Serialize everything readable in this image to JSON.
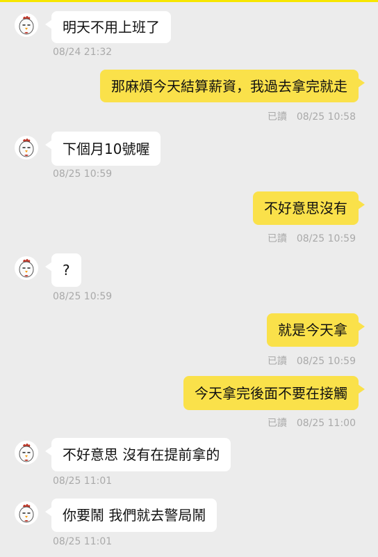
{
  "colors": {
    "background": "#ececec",
    "incoming_bubble": "#ffffff",
    "outgoing_bubble": "#fae14a",
    "timestamp": "#a9a9a9",
    "accent": "#f7e600"
  },
  "avatar_icon": "chicken-icon",
  "messages": [
    {
      "dir": "in",
      "text": "明天不用上班了",
      "time": "08/24 21:32"
    },
    {
      "dir": "out",
      "text": "那麻煩今天結算薪資，我過去拿完就走",
      "read": "已讀",
      "time": "08/25 10:58"
    },
    {
      "dir": "in",
      "text": "下個月10號喔",
      "time": "08/25 10:59"
    },
    {
      "dir": "out",
      "text": "不好意思沒有",
      "read": "已讀",
      "time": "08/25 10:59"
    },
    {
      "dir": "in",
      "text": "?",
      "time": "08/25 10:59"
    },
    {
      "dir": "out",
      "text": "就是今天拿",
      "read": "已讀",
      "time": "08/25 10:59"
    },
    {
      "dir": "out",
      "text": "今天拿完後面不要在接觸",
      "read": "已讀",
      "time": "08/25 11:00"
    },
    {
      "dir": "in",
      "text": "不好意思 沒有在提前拿的",
      "time": "08/25 11:01"
    },
    {
      "dir": "in",
      "text": "你要鬧 我們就去警局鬧",
      "time": "08/25 11:01"
    }
  ]
}
